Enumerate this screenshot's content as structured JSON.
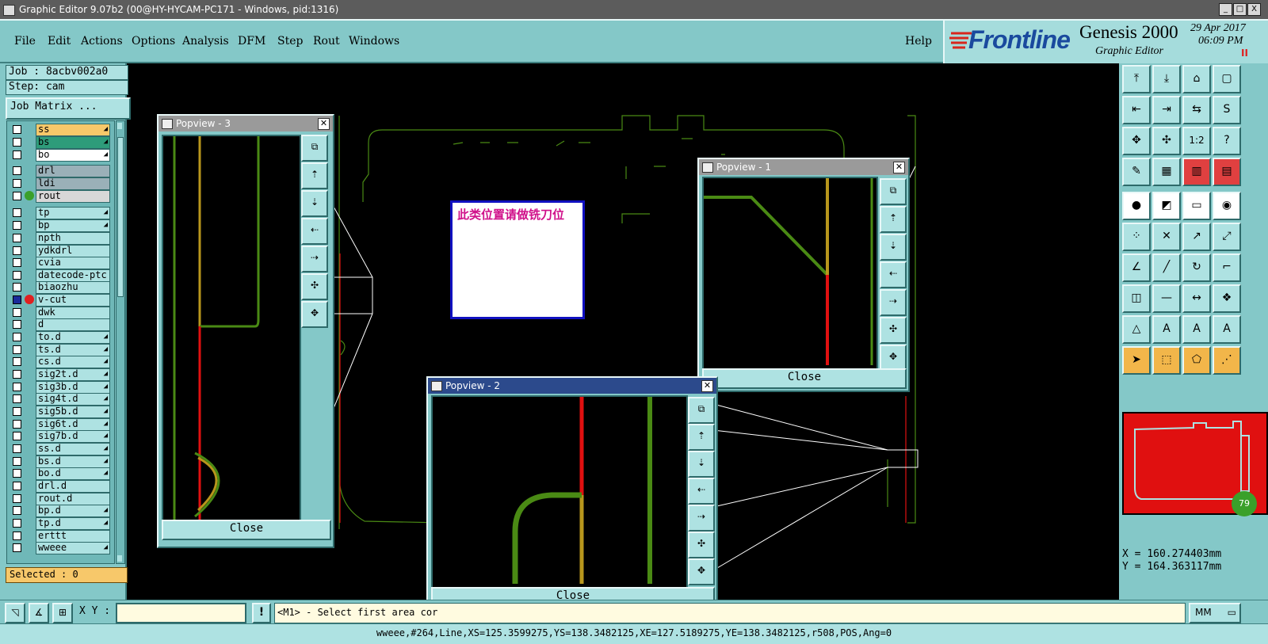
{
  "window": {
    "title": "Graphic Editor 9.07b2 (00@HY-HYCAM-PC171 - Windows, pid:1316)",
    "controls": [
      "_",
      "□",
      "X"
    ]
  },
  "menu": {
    "items": [
      "File",
      "Edit",
      "Actions",
      "Options",
      "Analysis",
      "DFM",
      "Step",
      "Rout",
      "Windows"
    ],
    "help": "Help"
  },
  "brand": {
    "logo": "Frontline",
    "product": "Genesis 2000",
    "subtitle": "Graphic Editor",
    "date": "29 Apr 2017",
    "time": "06:09 PM",
    "pause": "II"
  },
  "left_panel": {
    "job": "Job : 8acbv002a0",
    "step": "Step: cam",
    "job_matrix": "Job Matrix ...",
    "layers": [
      {
        "name": "ss",
        "color": "#f7c86a",
        "arrow": true
      },
      {
        "name": "bs",
        "color": "#2e9c7a",
        "arrow": true
      },
      {
        "name": "bo",
        "color": "#ffffff",
        "arrow": true
      },
      {
        "name": "drl",
        "color": "#9ab0b8",
        "arrow": false
      },
      {
        "name": "ldi",
        "color": "#9ab0b8",
        "arrow": false
      },
      {
        "name": "rout",
        "color": "#d8d8d8",
        "arrow": false,
        "dot": "#3aa02a"
      },
      {
        "name": "tp",
        "color": "#aee2e2",
        "arrow": true
      },
      {
        "name": "bp",
        "color": "#aee2e2",
        "arrow": true
      },
      {
        "name": "npth",
        "color": "#aee2e2",
        "arrow": false
      },
      {
        "name": "ydkdrl",
        "color": "#aee2e2",
        "arrow": false
      },
      {
        "name": "cvia",
        "color": "#aee2e2",
        "arrow": false
      },
      {
        "name": "datecode-ptc",
        "color": "#aee2e2",
        "arrow": false
      },
      {
        "name": "biaozhu",
        "color": "#aee2e2",
        "arrow": false
      },
      {
        "name": "v-cut",
        "color": "#aee2e2",
        "arrow": false,
        "dot": "#e02020",
        "selected": true
      },
      {
        "name": "dwk",
        "color": "#aee2e2",
        "arrow": false
      },
      {
        "name": "d",
        "color": "#aee2e2",
        "arrow": false
      },
      {
        "name": "to.d",
        "color": "#aee2e2",
        "arrow": true
      },
      {
        "name": "ts.d",
        "color": "#aee2e2",
        "arrow": true
      },
      {
        "name": "cs.d",
        "color": "#aee2e2",
        "arrow": true
      },
      {
        "name": "sig2t.d",
        "color": "#aee2e2",
        "arrow": true
      },
      {
        "name": "sig3b.d",
        "color": "#aee2e2",
        "arrow": true
      },
      {
        "name": "sig4t.d",
        "color": "#aee2e2",
        "arrow": true
      },
      {
        "name": "sig5b.d",
        "color": "#aee2e2",
        "arrow": true
      },
      {
        "name": "sig6t.d",
        "color": "#aee2e2",
        "arrow": true
      },
      {
        "name": "sig7b.d",
        "color": "#aee2e2",
        "arrow": true
      },
      {
        "name": "ss.d",
        "color": "#aee2e2",
        "arrow": true
      },
      {
        "name": "bs.d",
        "color": "#aee2e2",
        "arrow": true
      },
      {
        "name": "bo.d",
        "color": "#aee2e2",
        "arrow": true
      },
      {
        "name": "drl.d",
        "color": "#aee2e2",
        "arrow": false
      },
      {
        "name": "rout.d",
        "color": "#aee2e2",
        "arrow": false
      },
      {
        "name": "bp.d",
        "color": "#aee2e2",
        "arrow": true
      },
      {
        "name": "tp.d",
        "color": "#aee2e2",
        "arrow": true
      },
      {
        "name": "erttt",
        "color": "#aee2e2",
        "arrow": false
      },
      {
        "name": "wweee",
        "color": "#aee2e2",
        "arrow": true
      }
    ],
    "selected_label": "Selected : 0"
  },
  "annotation": {
    "text": "此类位置请做铣刀位"
  },
  "popviews": {
    "p1": {
      "title": "Popview - 1",
      "close": "Close"
    },
    "p2": {
      "title": "Popview - 2",
      "close": "Close"
    },
    "p3": {
      "title": "Popview - 3",
      "close": "Close"
    }
  },
  "right_panel": {
    "x_label": "X = ",
    "x_value": "160.274403mm",
    "y_label": "Y = ",
    "y_value": "164.363117mm",
    "badge": "79"
  },
  "cmdbar": {
    "xy_label": "X Y :",
    "xy_value": "",
    "bang": "!",
    "prompt": "<M1> - Select first area cor",
    "units": "MM"
  },
  "status": {
    "text": "wweee,#264,Line,XS=125.3599275,YS=138.3482125,XE=127.5189275,YE=138.3482125,r508,POS,Ang=0"
  },
  "colors": {
    "panel": "#84c8c8",
    "canvas": "#000000",
    "rout_green": "#4a8a14",
    "vcut_red": "#e01010",
    "gold": "#b8961c"
  }
}
